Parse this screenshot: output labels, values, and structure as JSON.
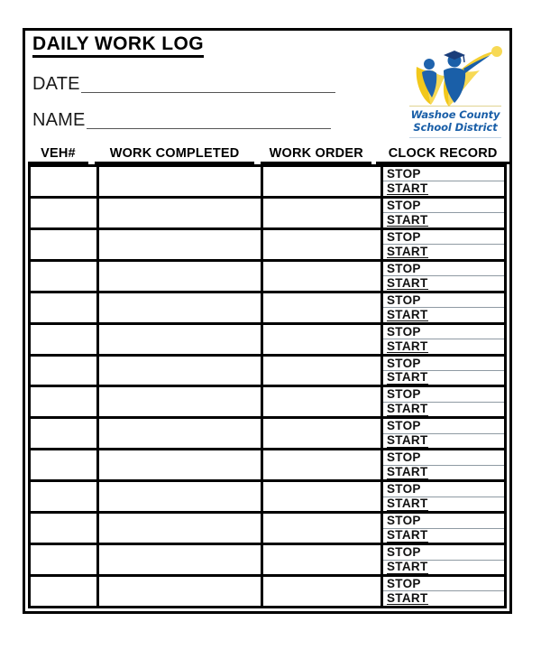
{
  "document": {
    "title": "DAILY WORK LOG",
    "fields": [
      {
        "label": "DATE",
        "value": ""
      },
      {
        "label": "NAME",
        "value": ""
      }
    ]
  },
  "logo": {
    "name": "washoe-county-school-district-logo",
    "line1": "Washoe County",
    "line2": "School District",
    "colors": {
      "blue": "#1a5fa8",
      "mid_blue": "#2e6db4",
      "gold": "#f4c81e",
      "light_gold": "#f7df7a"
    }
  },
  "table": {
    "columns": [
      {
        "key": "veh",
        "label": "VEH#"
      },
      {
        "key": "work_completed",
        "label": "WORK COMPLETED"
      },
      {
        "key": "work_order",
        "label": "WORK ORDER"
      },
      {
        "key": "clock_record",
        "label": "CLOCK RECORD"
      }
    ],
    "clock_labels": {
      "stop": "STOP",
      "start": "START"
    },
    "row_count": 14,
    "rows": [
      {
        "veh": "",
        "work_completed": "",
        "work_order": "",
        "stop": "STOP",
        "start": "START"
      },
      {
        "veh": "",
        "work_completed": "",
        "work_order": "",
        "stop": "STOP",
        "start": "START"
      },
      {
        "veh": "",
        "work_completed": "",
        "work_order": "",
        "stop": "STOP",
        "start": "START"
      },
      {
        "veh": "",
        "work_completed": "",
        "work_order": "",
        "stop": "STOP",
        "start": "START"
      },
      {
        "veh": "",
        "work_completed": "",
        "work_order": "",
        "stop": "STOP",
        "start": "START"
      },
      {
        "veh": "",
        "work_completed": "",
        "work_order": "",
        "stop": "STOP",
        "start": "START"
      },
      {
        "veh": "",
        "work_completed": "",
        "work_order": "",
        "stop": "STOP",
        "start": "START"
      },
      {
        "veh": "",
        "work_completed": "",
        "work_order": "",
        "stop": "STOP",
        "start": "START"
      },
      {
        "veh": "",
        "work_completed": "",
        "work_order": "",
        "stop": "STOP",
        "start": "START"
      },
      {
        "veh": "",
        "work_completed": "",
        "work_order": "",
        "stop": "STOP",
        "start": "START"
      },
      {
        "veh": "",
        "work_completed": "",
        "work_order": "",
        "stop": "STOP",
        "start": "START"
      },
      {
        "veh": "",
        "work_completed": "",
        "work_order": "",
        "stop": "STOP",
        "start": "START"
      },
      {
        "veh": "",
        "work_completed": "",
        "work_order": "",
        "stop": "STOP",
        "start": "START"
      },
      {
        "veh": "",
        "work_completed": "",
        "work_order": "",
        "stop": "STOP",
        "start": "START"
      }
    ]
  }
}
